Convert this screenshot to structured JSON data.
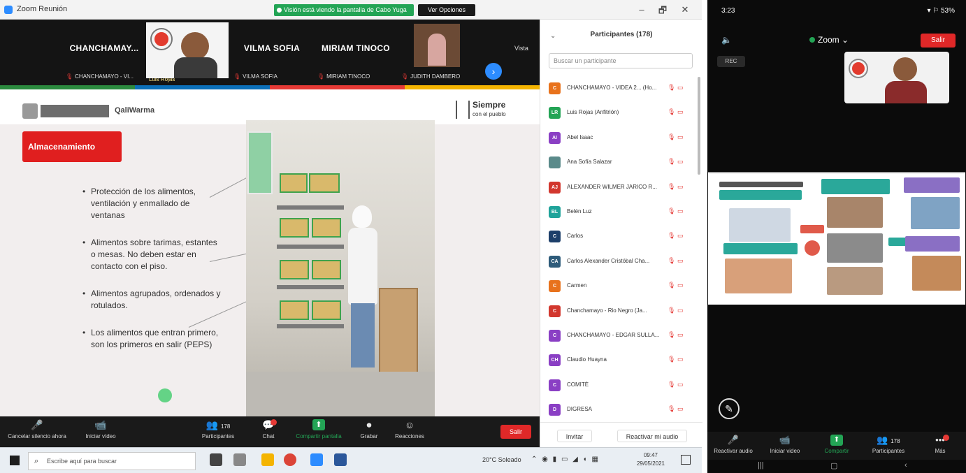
{
  "desktop": {
    "window_title": "Zoom Reunión",
    "share_banner": "Visión está viendo la pantalla de Cabo Yuga",
    "stop_share_label": "Ver Opciones",
    "window_controls": [
      "–",
      "🗗",
      "✕"
    ],
    "gallery": {
      "tiles": [
        {
          "name": "CHANCHAMAY...",
          "caption": "CHANCHAMAYO - VI..."
        },
        {
          "name": "",
          "caption": "Luis Rojas"
        },
        {
          "name": "VILMA SOFIA",
          "caption": "VILMA SOFIA"
        },
        {
          "name": "MIRIAM TINOCO",
          "caption": "MIRIAM TINOCO"
        },
        {
          "name": "",
          "caption": "JUDITH DAMBERO"
        }
      ],
      "view_label": "Vista"
    },
    "slide": {
      "brand": "QaliWarma",
      "motto": "Siempre",
      "motto_sub": "con el pueblo",
      "section_title": "Almacenamiento",
      "bullets": [
        "Protección de los alimentos, ventilación y enmallado de ventanas",
        "Alimentos sobre tarimas, estantes o mesas. No deben estar en contacto con el piso.",
        "Alimentos agrupados, ordenados y rotulados.",
        "Los alimentos que entran primero, son los primeros en salir (PEPS)"
      ]
    },
    "toolbar": {
      "buttons": [
        {
          "label": "Cancelar silencio ahora",
          "icon": "🎤"
        },
        {
          "label": "Iniciar vídeo",
          "icon": "📹"
        },
        {
          "label": "Participantes",
          "icon": "👥",
          "count": "178"
        },
        {
          "label": "Chat",
          "icon": "💬"
        },
        {
          "label": "Compartir pantalla",
          "icon": "⬆"
        },
        {
          "label": "Grabar",
          "icon": "⏺"
        },
        {
          "label": "Reacciones",
          "icon": "☺"
        }
      ],
      "leave_label": "Salir"
    },
    "participants": {
      "title": "Participantes (178)",
      "search_placeholder": "Buscar un participante",
      "items": [
        {
          "name": "CHANCHAMAYO - VIDEA 2... (Ho...",
          "initial": "C",
          "color": "#e8721c"
        },
        {
          "name": "Luis Rojas (Anfitrión)",
          "initial": "LR",
          "color": "#23a455"
        },
        {
          "name": "Abel Isaac",
          "initial": "AI",
          "color": "#8a3fc4"
        },
        {
          "name": "Ana Sofía Salazar",
          "initial": "",
          "color": "#5a8a8a"
        },
        {
          "name": "ALEXANDER WILMER JARICO R...",
          "initial": "AJ",
          "color": "#d2372e"
        },
        {
          "name": "Belén Luz",
          "initial": "BL",
          "color": "#1fa39a"
        },
        {
          "name": "Carlos",
          "initial": "C",
          "color": "#1d3f6a"
        },
        {
          "name": "Carlos Alexander Cristóbal Cha...",
          "initial": "CA",
          "color": "#2e5b7a"
        },
        {
          "name": "Carmen",
          "initial": "C",
          "color": "#e8721c"
        },
        {
          "name": "Chanchamayo - Rio Negro (Ja...",
          "initial": "C",
          "color": "#d2372e"
        },
        {
          "name": "CHANCHAMAYO - EDGAR SULLA...",
          "initial": "C",
          "color": "#8a3fc4"
        },
        {
          "name": "Claudio Huayna",
          "initial": "CH",
          "color": "#8a3fc4"
        },
        {
          "name": "COMITÉ",
          "initial": "C",
          "color": "#8a3fc4"
        },
        {
          "name": "DIGRESA",
          "initial": "D",
          "color": "#8a3fc4"
        }
      ],
      "invite_label": "Invitar",
      "unmute_label": "Reactivar mi audio"
    },
    "taskbar": {
      "search_placeholder": "Escribe aquí para buscar",
      "weather": "20°C Soleado",
      "time": "09:47",
      "date": "29/05/2021"
    }
  },
  "phone": {
    "status_time": "3:23",
    "status_right": "▾ ⚐ 53%",
    "app_label": "Zoom",
    "exit_label": "Salir",
    "rec_label": "REC",
    "toolbar": [
      {
        "label": "Reactivar audio",
        "icon": "🎤"
      },
      {
        "label": "Iniciar video",
        "icon": "📹"
      },
      {
        "label": "Compartir",
        "icon": "⬆"
      },
      {
        "label": "Participantes",
        "icon": "👥",
        "count": "178"
      },
      {
        "label": "Más",
        "icon": "•••"
      }
    ]
  },
  "colors": {
    "zoom_blue": "#2d8cff",
    "share_green": "#23a455",
    "leave_red": "#e02828",
    "section_red": "#e01f1f"
  }
}
